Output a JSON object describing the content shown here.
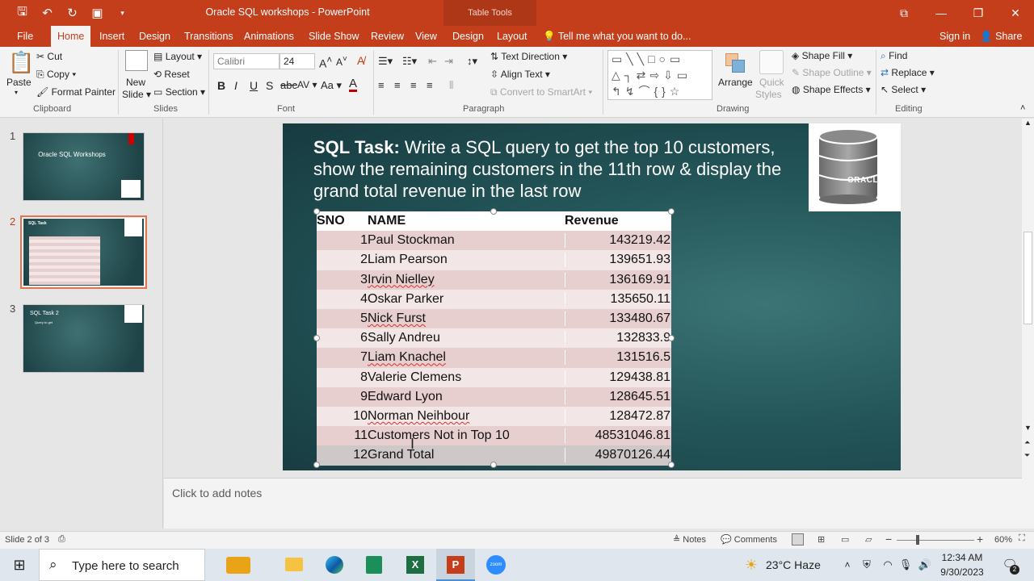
{
  "app": {
    "title": "Oracle SQL workshops - PowerPoint",
    "contextual_label": "Table Tools"
  },
  "tabs": [
    {
      "label": "File"
    },
    {
      "label": "Home"
    },
    {
      "label": "Insert"
    },
    {
      "label": "Design"
    },
    {
      "label": "Transitions"
    },
    {
      "label": "Animations"
    },
    {
      "label": "Slide Show"
    },
    {
      "label": "Review"
    },
    {
      "label": "View"
    },
    {
      "label": "Design"
    },
    {
      "label": "Layout"
    }
  ],
  "tell_me": "Tell me what you want to do...",
  "account": {
    "sign_in": "Sign in",
    "share": "Share"
  },
  "ribbon": {
    "clipboard": {
      "paste": "Paste",
      "cut": "Cut",
      "copy": "Copy",
      "format_painter": "Format Painter",
      "label": "Clipboard"
    },
    "slides": {
      "new_slide_1": "New",
      "new_slide_2": "Slide",
      "layout": "Layout",
      "reset": "Reset",
      "section": "Section",
      "label": "Slides"
    },
    "font": {
      "name": "Calibri",
      "size": "24",
      "label": "Font"
    },
    "paragraph": {
      "text_direction": "Text Direction",
      "align_text": "Align Text",
      "convert_smartart": "Convert to SmartArt",
      "label": "Paragraph"
    },
    "drawing": {
      "arrange": "Arrange",
      "quick_styles_1": "Quick",
      "quick_styles_2": "Styles",
      "shape_fill": "Shape Fill",
      "shape_outline": "Shape Outline",
      "shape_effects": "Shape Effects",
      "label": "Drawing"
    },
    "editing": {
      "find": "Find",
      "replace": "Replace",
      "select": "Select",
      "label": "Editing"
    }
  },
  "thumbnails": [
    {
      "num": "1",
      "title": "Oracle SQL Workshops"
    },
    {
      "num": "2",
      "title": "SQL Task"
    },
    {
      "num": "3",
      "title": "SQL Task 2",
      "bullet": "Query to get"
    }
  ],
  "slide": {
    "title_bold": "SQL Task:",
    "title_rest": " Write a SQL query to get the top 10 customers, show the remaining customers in the 11th row & display the grand total revenue in the last row",
    "logo_text": "ORACLE",
    "table": {
      "headers": [
        "SNO",
        "NAME",
        "Revenue"
      ],
      "rows": [
        {
          "sno": "1",
          "name": "Paul Stockman",
          "revenue": "143219.42"
        },
        {
          "sno": "2",
          "name": "Liam Pearson",
          "revenue": "139651.93"
        },
        {
          "sno": "3",
          "name": "Irvin Nielley",
          "revenue": "136169.91"
        },
        {
          "sno": "4",
          "name": "Oskar Parker",
          "revenue": "135650.11"
        },
        {
          "sno": "5",
          "name": "Nick Furst",
          "revenue": "133480.67"
        },
        {
          "sno": "6",
          "name": "Sally Andreu",
          "revenue": "132833.9"
        },
        {
          "sno": "7",
          "name": "Liam Knachel",
          "revenue": "131516.5"
        },
        {
          "sno": "8",
          "name": "Valerie Clemens",
          "revenue": "129438.81"
        },
        {
          "sno": "9",
          "name": "Edward Lyon",
          "revenue": "128645.51"
        },
        {
          "sno": "10",
          "name": "Norman Neihbour",
          "revenue": "128472.87"
        },
        {
          "sno": "11",
          "name": "Customers Not in Top 10",
          "revenue": "48531046.81"
        },
        {
          "sno": "12",
          "name": "Grand Total",
          "revenue": "49870126.44"
        }
      ]
    }
  },
  "notes_placeholder": "Click to add notes",
  "status": {
    "slide_info": "Slide 2 of 3",
    "notes": "Notes",
    "comments": "Comments",
    "zoom": "60%"
  },
  "taskbar": {
    "search_placeholder": "Type here to search",
    "weather": "23°C  Haze",
    "time": "12:34 AM",
    "date": "9/30/2023",
    "notif_count": "2"
  }
}
